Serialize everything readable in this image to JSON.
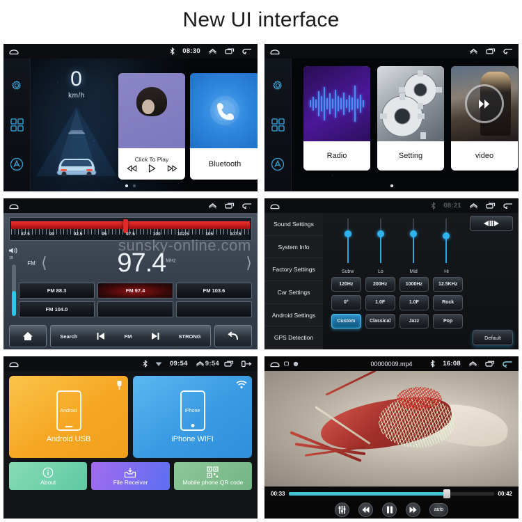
{
  "title": "New UI interface",
  "watermark": "sunsky-online.com",
  "panels": {
    "home": {
      "statusbar": {
        "bluetooth_icon": "bluetooth-icon",
        "time": "08:30",
        "up_icon": "chevron-up-icon",
        "recents_icon": "recents-icon",
        "back_icon": "back-icon",
        "home_icon": "home-icon"
      },
      "rail": [
        {
          "name": "settings",
          "icon": "gear-icon"
        },
        {
          "name": "apps",
          "icon": "grid-apps-icon"
        },
        {
          "name": "assistant",
          "icon": "a-circle-icon"
        }
      ],
      "speed_value": "0",
      "speed_unit": "km/h",
      "music": {
        "caption": "Click To Play",
        "prev_icon": "previous-icon",
        "play_icon": "play-icon",
        "next_icon": "next-icon"
      },
      "bluetooth": {
        "label": "Bluetooth",
        "icon": "phone-handset-icon"
      },
      "page_dots": 2,
      "active_dot": 0
    },
    "apps": {
      "statusbar": {
        "home_icon": "home-icon",
        "up_icon": "chevron-up-icon",
        "recents_icon": "recents-icon",
        "back_icon": "back-icon"
      },
      "tiles": [
        {
          "label": "Radio",
          "thumb": "audio-waveform-thumb"
        },
        {
          "label": "Setting",
          "thumb": "gears-thumb"
        },
        {
          "label": "video",
          "thumb": "movie-poster-thumb",
          "overlay_icon": "play-forward-icon"
        }
      ],
      "page_dots": 1,
      "active_dot": 0
    },
    "radio": {
      "statusbar": {
        "home_icon": "home-icon",
        "up_icon": "chevron-up-icon",
        "recents_icon": "recents-icon",
        "back_icon": "back-icon"
      },
      "scale_labels": [
        "87.5",
        "90",
        "92.5",
        "95",
        "97.5",
        "100",
        "102.5",
        "105",
        "107.5"
      ],
      "needle_percent": 47,
      "volume_label": "10",
      "volume_percent": 32,
      "band": "FM",
      "frequency": "97.4",
      "frequency_unit": "MHz",
      "prev_icon": "chevron-left-icon",
      "next_icon": "chevron-right-icon",
      "presets": [
        {
          "label": "FM 88.3",
          "active": false
        },
        {
          "label": "FM 97.4",
          "active": true
        },
        {
          "label": "FM 103.6",
          "active": false
        },
        {
          "label": "FM 104.0",
          "active": false
        },
        {
          "label": "",
          "active": false
        },
        {
          "label": "",
          "active": false
        }
      ],
      "controls": {
        "home_icon": "home-icon",
        "search_label": "Search",
        "prev_icon": "skip-previous-icon",
        "band_label": "FM",
        "next_icon": "skip-next-icon",
        "strong_label": "STRONG",
        "back_icon": "return-arrow-icon"
      }
    },
    "eq": {
      "statusbar": {
        "home_icon": "home-icon",
        "time": "08:21",
        "bluetooth_icon": "bluetooth-icon",
        "up_icon": "chevron-up-icon",
        "recents_icon": "recents-icon",
        "back_icon": "back-icon"
      },
      "menu": [
        "Sound Settings",
        "System Info",
        "Factory Settings",
        "Car Settings",
        "Android Settings",
        "GPS Detection"
      ],
      "sliders": [
        {
          "label": "Subw",
          "value": 62
        },
        {
          "label": "Lo",
          "value": 62
        },
        {
          "label": "Mid",
          "value": 62
        },
        {
          "label": "Hi",
          "value": 55
        }
      ],
      "balance_icon": "balance-lr-icon",
      "buttons": [
        {
          "label": "120Hz",
          "selected": false
        },
        {
          "label": "200Hz",
          "selected": false
        },
        {
          "label": "1000Hz",
          "selected": false
        },
        {
          "label": "12.5KHz",
          "selected": false
        },
        {
          "label": "0°",
          "selected": false
        },
        {
          "label": "1.0F",
          "selected": false
        },
        {
          "label": "1.0F",
          "selected": false
        },
        {
          "label": "Rock",
          "selected": false
        },
        {
          "label": "Custom",
          "selected": true
        },
        {
          "label": "Classical",
          "selected": false
        },
        {
          "label": "Jazz",
          "selected": false
        },
        {
          "label": "Pop",
          "selected": false
        }
      ],
      "default_label": "Default"
    },
    "link": {
      "statusbar": {
        "home_icon": "home-icon",
        "bluetooth_icon": "bluetooth-icon",
        "wifi_icon": "wifi-icon",
        "time": "09:54",
        "up_icon": "chevron-up-icon",
        "overlay_time": "9:54",
        "recents_icon": "recents-icon",
        "back_icon": "back-icon"
      },
      "top_tiles": [
        {
          "label": "Android USB",
          "phone_text": "Android",
          "corner_icon": "usb-icon"
        },
        {
          "label": "iPhone WIFI",
          "phone_text": "iPhone",
          "corner_icon": "wifi-icon"
        }
      ],
      "bottom_tiles": [
        {
          "label": "About",
          "icon": "info-circle-icon"
        },
        {
          "label": "File Receiver",
          "icon": "inbox-download-icon"
        },
        {
          "label": "Mobile phone QR code",
          "icon": "qr-code-icon"
        }
      ]
    },
    "video": {
      "statusbar": {
        "home_icon": "home-icon",
        "filename": "00000009.mp4",
        "bluetooth_icon": "bluetooth-icon",
        "time": "16:08",
        "up_icon": "chevron-up-icon",
        "recents_icon": "recents-icon",
        "back_icon": "back-icon"
      },
      "current_time": "00:33",
      "total_time": "00:42",
      "progress_percent": 77,
      "controls": [
        {
          "name": "equalizer",
          "icon": "equalizer-sliders-icon"
        },
        {
          "name": "previous",
          "icon": "skip-previous-icon"
        },
        {
          "name": "pause",
          "icon": "pause-icon"
        },
        {
          "name": "next",
          "icon": "skip-next-icon"
        },
        {
          "name": "auto",
          "label": "auto"
        }
      ]
    }
  },
  "colors": {
    "accent_blue": "#2fb3ee",
    "radio_red": "#e02a2a",
    "seek_teal": "#41c8d6",
    "android_orange": "#f5a623",
    "iphone_blue": "#3a9ae2"
  }
}
